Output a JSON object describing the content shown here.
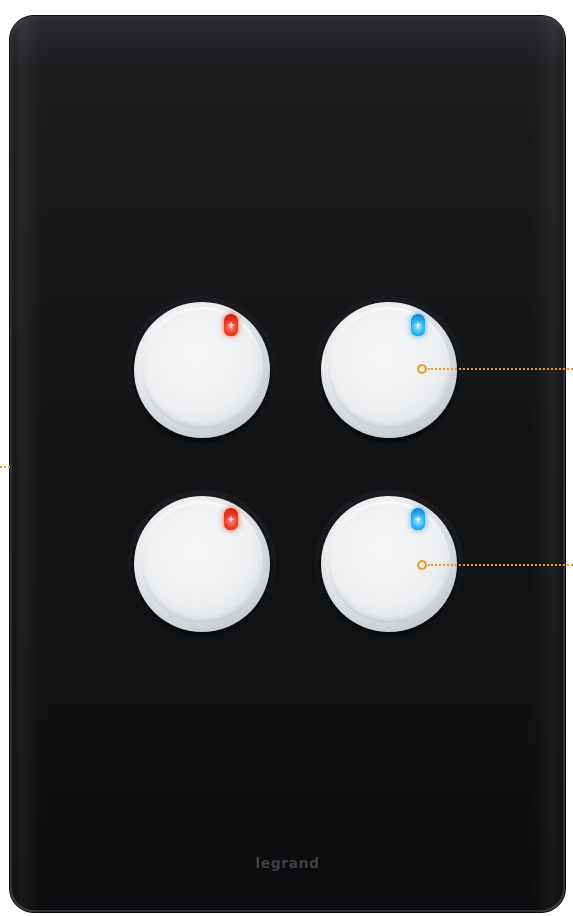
{
  "device": {
    "type": "four-gang push-button wall plate",
    "plate_color": "#121315",
    "button_color": "#eceef0",
    "brand_label": "legrand"
  },
  "buttons": [
    {
      "id": "top-left",
      "indicator_color": "#ee3a23",
      "indicator_name": "red-led-icon"
    },
    {
      "id": "top-right",
      "indicator_color": "#2ab2f0",
      "indicator_name": "blue-led-icon"
    },
    {
      "id": "bottom-left",
      "indicator_color": "#ee3a23",
      "indicator_name": "red-led-icon"
    },
    {
      "id": "bottom-right",
      "indicator_color": "#2ab2f0",
      "indicator_name": "blue-led-icon"
    }
  ],
  "callouts": {
    "color": "#f39a1e"
  }
}
